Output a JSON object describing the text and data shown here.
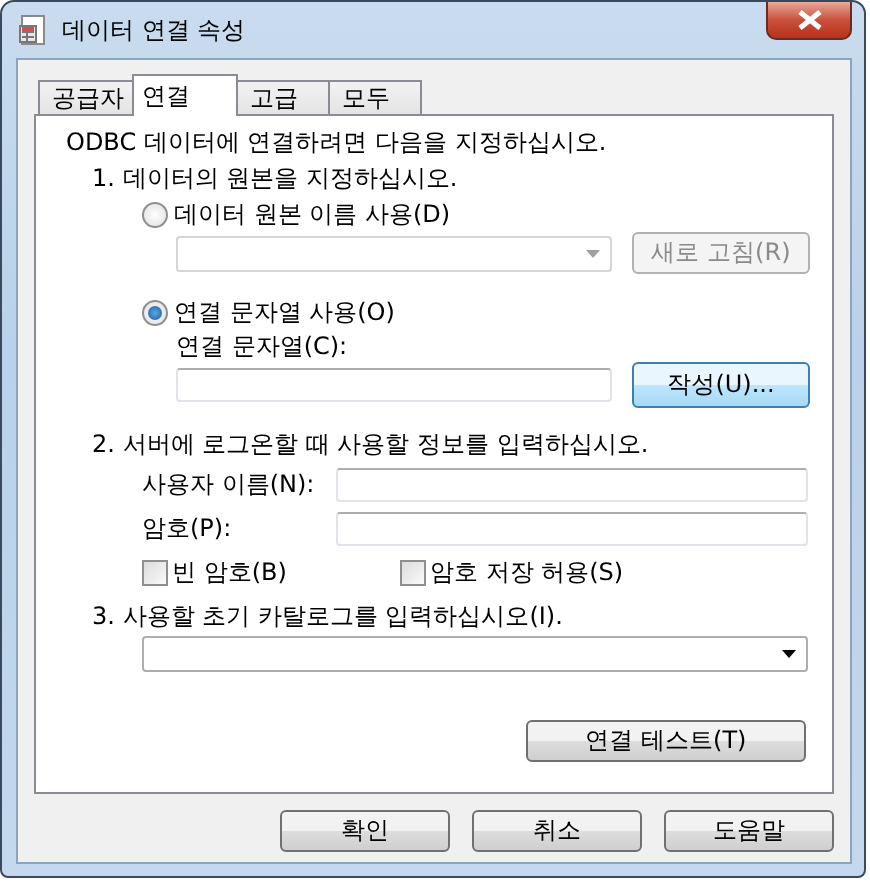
{
  "window": {
    "title": "데이터 연결 속성"
  },
  "tabs": [
    {
      "label": "공급자",
      "selected": false
    },
    {
      "label": "연결",
      "selected": true
    },
    {
      "label": "고급",
      "selected": false
    },
    {
      "label": "모두",
      "selected": false
    }
  ],
  "intro": "ODBC 데이터에 연결하려면 다음을 지정하십시오.",
  "step1": {
    "heading": "1. 데이터의 원본을 지정하십시오.",
    "options": [
      {
        "label": "데이터 원본 이름 사용(D)",
        "selected": false
      },
      {
        "label": "연결 문자열 사용(O)",
        "selected": true
      }
    ],
    "dsn_dropdown": {
      "disabled": true
    },
    "refresh_button": {
      "label": "새로 고침(R)",
      "disabled": true
    },
    "connection_string_label": "연결 문자열(C):",
    "build_button": "작성(U)..."
  },
  "step2": {
    "heading": "2. 서버에 로그온할 때 사용할 정보를 입력하십시오.",
    "user_name_label": "사용자 이름(N):",
    "password_label": "암호(P):",
    "checkboxes": [
      {
        "label": "빈 암호(B)",
        "checked": false
      },
      {
        "label": "암호 저장 허용(S)",
        "checked": false
      }
    ]
  },
  "step3": {
    "heading": "3. 사용할 초기 카탈로그를 입력하십시오(I)."
  },
  "test_button": "연결 테스트(T)",
  "buttons": [
    "확인",
    "취소",
    "도움말"
  ]
}
